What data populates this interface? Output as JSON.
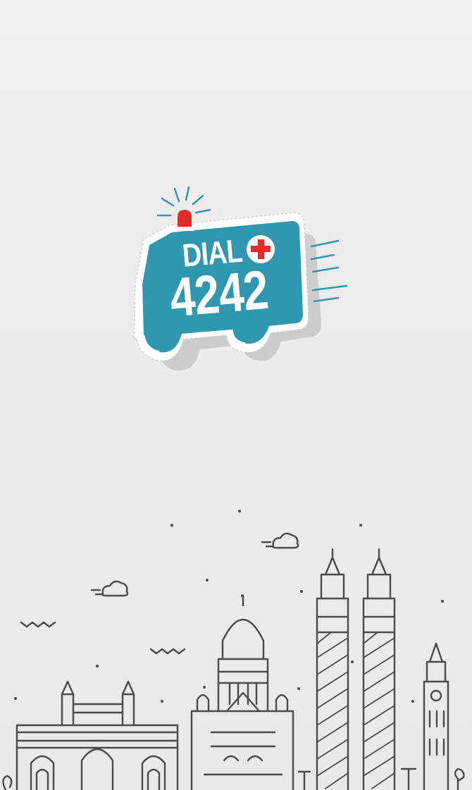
{
  "app": {
    "logo": {
      "word": "DIAL",
      "number": "4242",
      "icon": "ambulance-icon",
      "colors": {
        "van": "#2f97b0",
        "siren": "#e32b2b",
        "cross": "#e32b2b",
        "rays": "#2f97b0",
        "text": "#ffffff"
      }
    },
    "illustration": {
      "icon": "city-skyline-icon",
      "line_color": "#4a4a4a"
    },
    "background_color": "#ececec"
  }
}
